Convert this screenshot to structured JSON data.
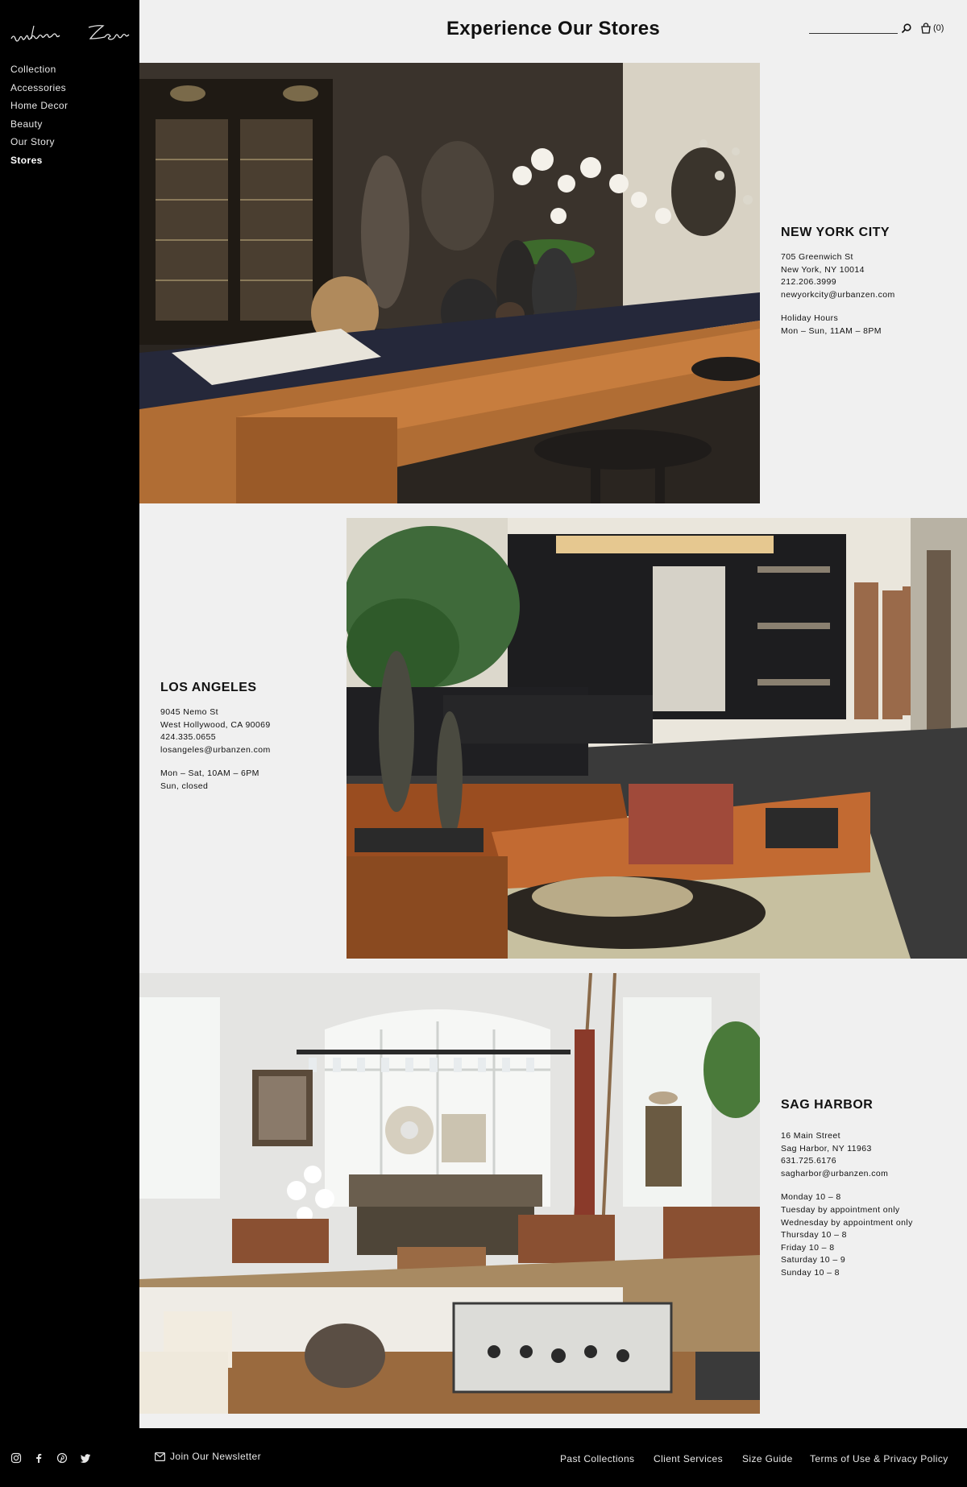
{
  "brand": {
    "logo_text": "urbanZen"
  },
  "nav": {
    "items": [
      {
        "label": "Collection"
      },
      {
        "label": "Accessories"
      },
      {
        "label": "Home Decor"
      },
      {
        "label": "Beauty"
      },
      {
        "label": "Our Story"
      },
      {
        "label": "Stores",
        "active": true
      }
    ]
  },
  "header": {
    "title": "Experience Our Stores",
    "search_placeholder": "",
    "cart_count": "(0)"
  },
  "stores": [
    {
      "name": "NEW YORK CITY",
      "address_lines": [
        "705 Greenwich St",
        "New York, NY 10014",
        "212.206.3999",
        "newyorkcity@urbanzen.com"
      ],
      "hours_lines": [
        "Holiday Hours",
        "Mon – Sun, 11AM – 8PM"
      ]
    },
    {
      "name": "LOS ANGELES",
      "address_lines": [
        "9045 Nemo St",
        "West Hollywood, CA 90069",
        "424.335.0655",
        "losangeles@urbanzen.com"
      ],
      "hours_lines": [
        "Mon – Sat, 10AM – 6PM",
        "Sun, closed"
      ]
    },
    {
      "name": "SAG HARBOR",
      "address_lines": [
        "16 Main Street",
        "Sag Harbor, NY 11963",
        "631.725.6176",
        "sagharbor@urbanzen.com"
      ],
      "hours_lines": [
        "Monday 10 – 8",
        "Tuesday by appointment only",
        "Wednesday by appointment only",
        "Thursday 10 – 8",
        "Friday 10 – 8",
        "Saturday 10 – 9",
        "Sunday 10 – 8"
      ]
    }
  ],
  "footer": {
    "newsletter_label": "Join Our Newsletter",
    "links": [
      "Past Collections",
      "Client Services",
      "Size Guide",
      "Terms of Use & Privacy Policy"
    ],
    "social_icons": [
      "instagram-icon",
      "facebook-icon",
      "pinterest-icon",
      "twitter-icon"
    ]
  },
  "colors": {
    "sidebar_bg": "#000000",
    "page_bg": "#f0f0f0",
    "text": "#111111"
  }
}
